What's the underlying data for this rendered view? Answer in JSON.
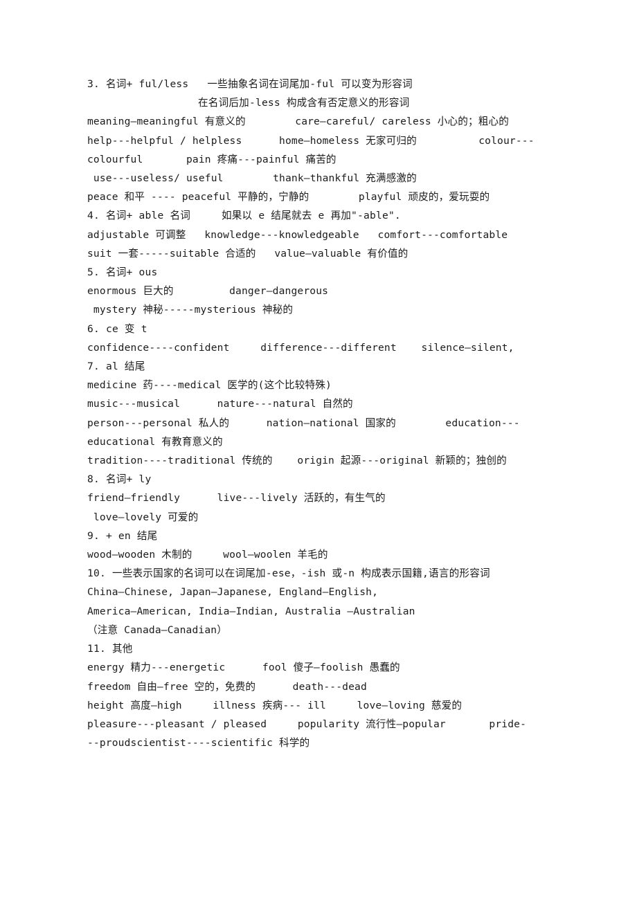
{
  "document": {
    "page_background": "#ffffff",
    "text_color": "#1b1b1b",
    "lines": [
      {
        "id": "l01",
        "text": "3. 名词+ ful/less   一些抽象名词在词尾加-ful 可以变为形容词",
        "indent": "none",
        "role": "heading"
      },
      {
        "id": "l02",
        "text": "在名词后加-less 构成含有否定意义的形容词",
        "indent": "center",
        "role": "heading"
      },
      {
        "id": "l03",
        "text": "meaning—meaningful 有意义的        care—careful/ careless 小心的；粗心的",
        "indent": "none",
        "role": "entry"
      },
      {
        "id": "l04",
        "text": "help---helpful / helpless      home—homeless 无家可归的          colour---",
        "indent": "none",
        "role": "entry"
      },
      {
        "id": "l05",
        "text": "colourful       pain 疼痛---painful 痛苦的",
        "indent": "none",
        "role": "entry"
      },
      {
        "id": "l06",
        "text": " use---useless/ useful        thank—thankful 充满感激的",
        "indent": "none",
        "role": "entry"
      },
      {
        "id": "l07",
        "text": "peace 和平 ---- peaceful 平静的，宁静的        playful 顽皮的，爱玩耍的",
        "indent": "none",
        "role": "entry"
      },
      {
        "id": "l08",
        "text": "4. 名词+ able 名词     如果以 e 结尾就去 e 再加\"-able\".",
        "indent": "none",
        "role": "heading"
      },
      {
        "id": "l09",
        "text": "adjustable 可调整   knowledge---knowledgeable   comfort---comfortable",
        "indent": "none",
        "role": "entry"
      },
      {
        "id": "l10",
        "text": "suit 一套-----suitable 合适的   value—valuable 有价值的",
        "indent": "none",
        "role": "entry"
      },
      {
        "id": "l11",
        "text": "5. 名词+ ous",
        "indent": "none",
        "role": "heading"
      },
      {
        "id": "l12",
        "text": "enormous 巨大的         danger—dangerous",
        "indent": "none",
        "role": "entry"
      },
      {
        "id": "l13",
        "text": " mystery 神秘-----mysterious 神秘的",
        "indent": "none",
        "role": "entry"
      },
      {
        "id": "l14",
        "text": "6. ce 变 t",
        "indent": "none",
        "role": "heading"
      },
      {
        "id": "l15",
        "text": "confidence----confident     difference---different    silence—silent,",
        "indent": "none",
        "role": "entry"
      },
      {
        "id": "l16",
        "text": "7. al 结尾",
        "indent": "none",
        "role": "heading"
      },
      {
        "id": "l17",
        "text": "medicine 药----medical 医学的(这个比较特殊)",
        "indent": "none",
        "role": "entry"
      },
      {
        "id": "l18",
        "text": "music---musical      nature---natural 自然的",
        "indent": "none",
        "role": "entry"
      },
      {
        "id": "l19",
        "text": "person---personal 私人的      nation—national 国家的        education---",
        "indent": "none",
        "role": "entry"
      },
      {
        "id": "l20",
        "text": "educational 有教育意义的",
        "indent": "none",
        "role": "entry"
      },
      {
        "id": "l21",
        "text": "tradition----traditional 传统的    origin 起源---original 新颖的；独创的",
        "indent": "none",
        "role": "entry"
      },
      {
        "id": "l22",
        "text": "8. 名词+ ly",
        "indent": "none",
        "role": "heading"
      },
      {
        "id": "l23",
        "text": "friend—friendly      live---lively 活跃的，有生气的",
        "indent": "none",
        "role": "entry"
      },
      {
        "id": "l24",
        "text": " love—lovely 可爱的",
        "indent": "none",
        "role": "entry"
      },
      {
        "id": "l25",
        "text": "9. + en 结尾",
        "indent": "none",
        "role": "heading"
      },
      {
        "id": "l26",
        "text": "wood—wooden 木制的     wool—woolen 羊毛的",
        "indent": "none",
        "role": "entry"
      },
      {
        "id": "l27",
        "text": "10. 一些表示国家的名词可以在词尾加-ese，-ish 或-n 构成表示国籍,语言的形容词",
        "indent": "none",
        "role": "heading"
      },
      {
        "id": "l28",
        "text": "China—Chinese, Japan—Japanese, England—English,",
        "indent": "none",
        "role": "entry"
      },
      {
        "id": "l29",
        "text": "America—American, India—Indian, Australia —Australian",
        "indent": "none",
        "role": "entry"
      },
      {
        "id": "l30",
        "text": "（注意 Canada—Canadian）",
        "indent": "none",
        "role": "entry"
      },
      {
        "id": "l31",
        "text": "11. 其他",
        "indent": "none",
        "role": "heading"
      },
      {
        "id": "l32",
        "text": "energy 精力---energetic      fool 傻子—foolish 愚蠢的",
        "indent": "none",
        "role": "entry"
      },
      {
        "id": "l33",
        "text": "freedom 自由—free 空的，免费的      death---dead",
        "indent": "none",
        "role": "entry"
      },
      {
        "id": "l34",
        "text": "height 高度—high     illness 疾病--- ill     love—loving 慈爱的",
        "indent": "none",
        "role": "entry"
      },
      {
        "id": "l35",
        "text": "pleasure---pleasant / pleased     popularity 流行性—popular       pride-",
        "indent": "none",
        "role": "entry"
      },
      {
        "id": "l36",
        "text": "--proudscientist----scientific 科学的",
        "indent": "none",
        "role": "entry"
      }
    ]
  }
}
